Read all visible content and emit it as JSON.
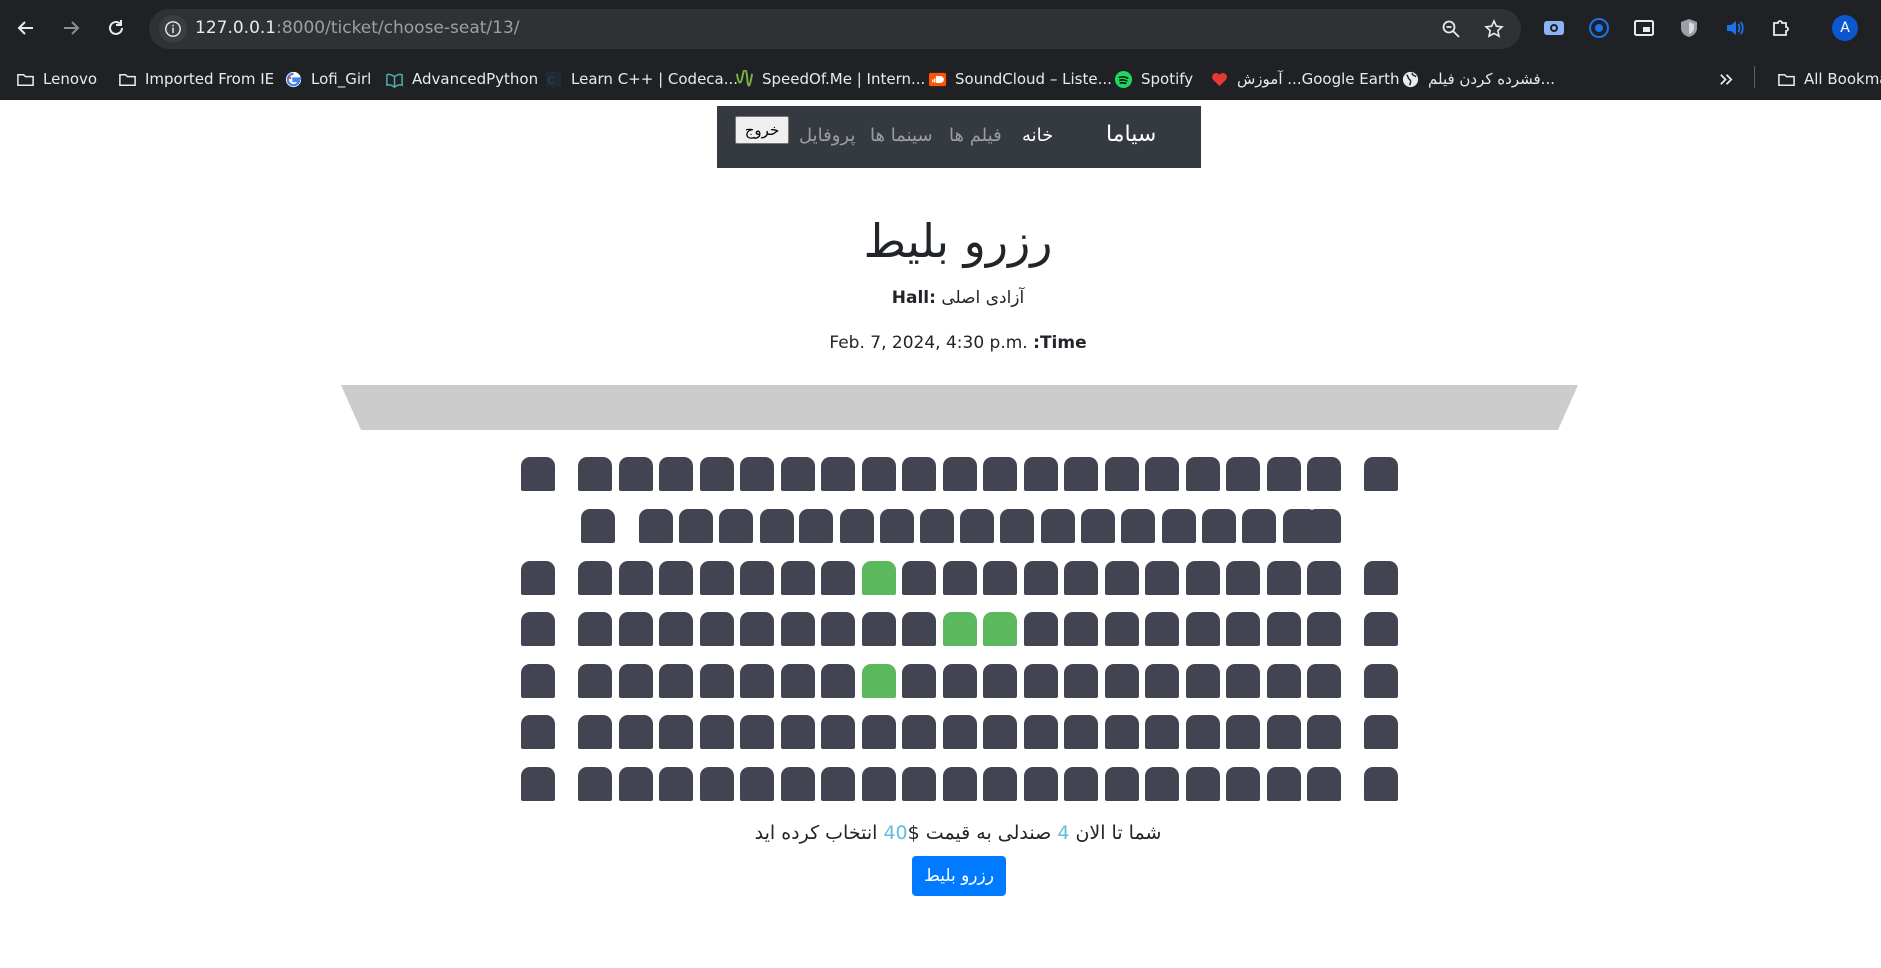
{
  "browser": {
    "url_host": "127.0.0.1",
    "url_path": ":8000/ticket/choose-seat/13/",
    "profile_initial": "A",
    "bookmarks": [
      {
        "label": "Lenovo",
        "icon": "folder-icon"
      },
      {
        "label": "Imported From IE",
        "icon": "folder-icon"
      },
      {
        "label": "Lofi_Girl",
        "icon": "google-icon"
      },
      {
        "label": "AdvancedPython",
        "icon": "book-icon"
      },
      {
        "label": "Learn C++ | Codeca...",
        "icon": "codecademy-icon"
      },
      {
        "label": "SpeedOf.Me | Intern...",
        "icon": "speedometer-icon"
      },
      {
        "label": "SoundCloud – Liste...",
        "icon": "soundcloud-icon"
      },
      {
        "label": "Spotify",
        "icon": "spotify-icon"
      },
      {
        "label": "آموزش ...Google Earth",
        "icon": "heart-icon"
      },
      {
        "label": "فشرده کردن فیلم...",
        "icon": "globe-icon"
      }
    ],
    "all_bookmarks_label": "All Bookmarks"
  },
  "navbar": {
    "brand": "سیاما",
    "links": [
      {
        "label": "خانه",
        "active": true
      },
      {
        "label": "فیلم ها",
        "active": false
      },
      {
        "label": "سینما ها",
        "active": false
      },
      {
        "label": "پروفایل",
        "active": false
      }
    ],
    "logout_label": "خروج"
  },
  "page": {
    "title": "رزرو بلیط",
    "hall_label": "Hall:",
    "hall_value": "آزادی اصلی",
    "time_label": "Time:",
    "time_value": "Feb. 7, 2024, 4:30 p.m."
  },
  "seat_map": {
    "rows": 7,
    "seats_per_row": [
      21,
      19,
      21,
      21,
      21,
      21,
      21
    ],
    "selected": [
      {
        "row": 3,
        "seat": 9
      },
      {
        "row": 4,
        "seat": 11
      },
      {
        "row": 4,
        "seat": 12
      },
      {
        "row": 5,
        "seat": 9
      }
    ],
    "colors": {
      "available": "#434451",
      "selected": "#5cb85c",
      "screen": "#cccccc"
    }
  },
  "summary": {
    "prefix": "شما تا الان",
    "count": "4",
    "middle": "صندلی به قیمت $",
    "price": "40",
    "suffix": "انتخاب کرده اید"
  },
  "reserve_button": "رزرو بلیط",
  "accent_color": "#007bff"
}
